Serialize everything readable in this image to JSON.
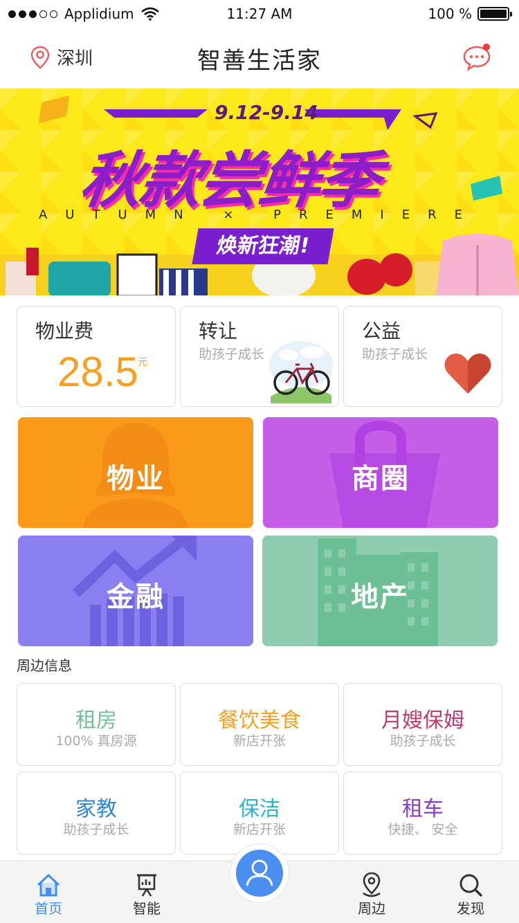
{
  "status_bar": {
    "carrier": "Applidium",
    "time": "11:27 AM",
    "battery": "100 %",
    "signal_dots": 5,
    "signal_filled": 3,
    "battery_level": 1.0
  },
  "nav": {
    "location": "深圳",
    "title": "智善生活家",
    "icons": {
      "location": "location-pin-icon",
      "messages": "message-bubble-icon"
    }
  },
  "banner": {
    "date": "9.12-9.14",
    "title": "秋款尝鲜季",
    "subtitle": "AUTUMN × PREMIERE",
    "tag": "焕新狂潮!"
  },
  "cards": {
    "fee": {
      "title": "物业费",
      "value": "28.5",
      "unit": "元"
    },
    "transfer": {
      "title": "转让",
      "subtitle": "助孩子成长",
      "icon": "bicycle-icon"
    },
    "charity": {
      "title": "公益",
      "subtitle": "助孩子成长",
      "icon": "heart-icon"
    }
  },
  "tiles": [
    {
      "label": "物业",
      "color": "#fb9a1a",
      "icon": "person-silhouette-icon"
    },
    {
      "label": "商圈",
      "color": "#c65ee8",
      "icon": "shopping-bag-icon"
    },
    {
      "label": "金融",
      "color": "#8a7ef0",
      "icon": "growth-chart-icon"
    },
    {
      "label": "地产",
      "color": "#8ecdb1",
      "icon": "buildings-icon"
    }
  ],
  "nearby": {
    "title": "周边信息",
    "items": [
      {
        "title": "租房",
        "subtitle": "100% 真房源",
        "color": "#6fbf99"
      },
      {
        "title": "餐饮美食",
        "subtitle": "新店开张",
        "color": "#f5a021"
      },
      {
        "title": "月嫂保姆",
        "subtitle": "助孩子成长",
        "color": "#c23a6a"
      },
      {
        "title": "家教",
        "subtitle": "助孩子成长",
        "color": "#2f86d8"
      },
      {
        "title": "保洁",
        "subtitle": "新店开张",
        "color": "#2bb3c9"
      },
      {
        "title": "租车",
        "subtitle": "快捷、  安全",
        "color": "#8a3cc0"
      }
    ]
  },
  "tabbar": {
    "items": [
      {
        "label": "首页",
        "icon": "home-icon",
        "active": true
      },
      {
        "label": "智能",
        "icon": "presentation-icon",
        "active": false
      },
      {
        "label": "周边",
        "icon": "location-pin-icon",
        "active": false
      },
      {
        "label": "发现",
        "icon": "search-icon",
        "active": false
      }
    ],
    "center_icon": "user-avatar-icon"
  },
  "colors": {
    "accent": "#3f8ff0",
    "fee": "#f5a021",
    "banner_bg": "#fde81a",
    "banner_purple": "#8b1ec9"
  }
}
